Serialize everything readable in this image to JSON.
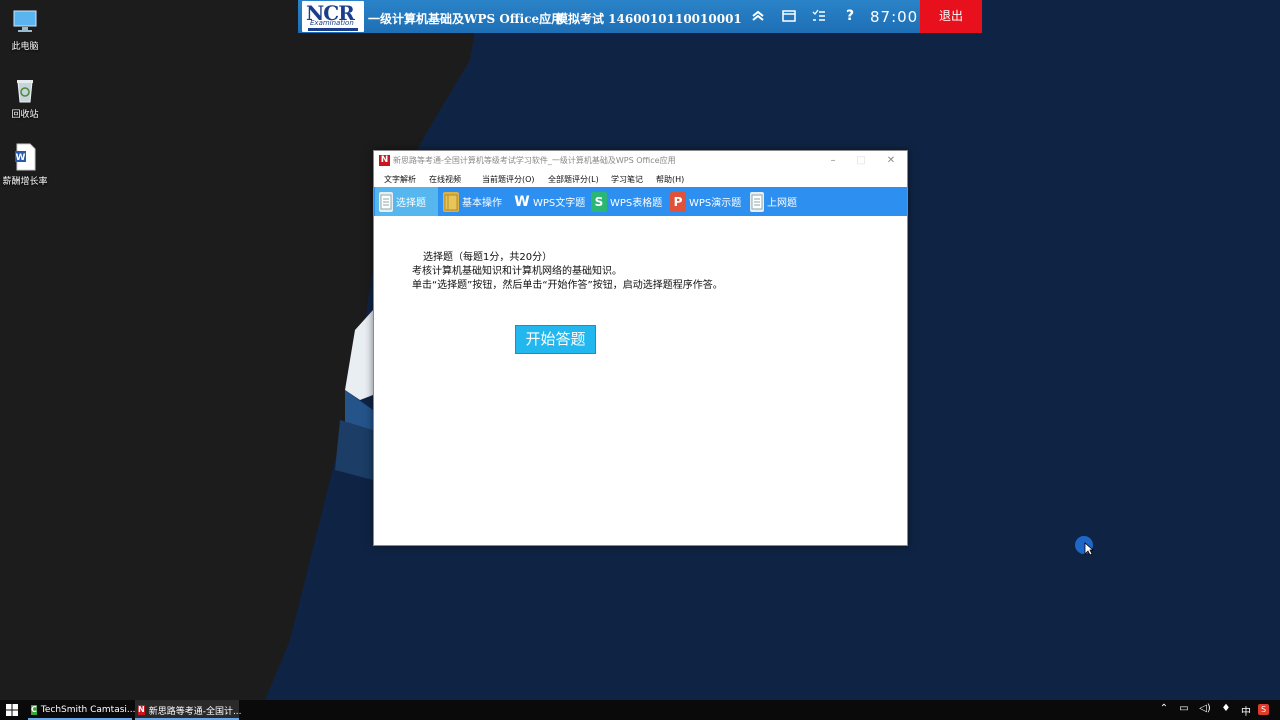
{
  "desktop": {
    "icons": [
      {
        "label": "此电脑",
        "icon": "computer-icon"
      },
      {
        "label": "回收站",
        "icon": "recycle-bin-icon"
      },
      {
        "label": "薪酬增长率",
        "icon": "word-document-icon"
      }
    ]
  },
  "exam_bar": {
    "logo_text": "NCR",
    "logo_sub": "Examination",
    "title": "一级计算机基础及WPS Office应用",
    "exam_label": "模拟考试 1460010110010001",
    "icons": [
      "collapse-icon",
      "window-icon",
      "question-list-icon",
      "help-icon"
    ],
    "help_label": "?",
    "timer": "87:00",
    "exit_label": "退出",
    "colors": {
      "bar": "#1e6fb5",
      "exit": "#e8101c"
    }
  },
  "app_window": {
    "title": "新思路等考通-全国计算机等级考试学习软件_一级计算机基础及WPS Office应用",
    "app_icon_letter": "N",
    "menu": [
      "文字解析",
      "在线视频",
      "当前题评分(O)",
      "全部题评分(L)",
      "学习笔记",
      "帮助(H)"
    ],
    "toolbar": [
      {
        "label": "选择题",
        "icon": "choice-doc-icon",
        "active": true
      },
      {
        "label": "基本操作",
        "icon": "folder-icon",
        "active": false
      },
      {
        "label": "WPS文字题",
        "icon": "wps-writer-icon",
        "active": false
      },
      {
        "label": "WPS表格题",
        "icon": "wps-spreadsheet-icon",
        "active": false
      },
      {
        "label": "WPS演示题",
        "icon": "wps-presentation-icon",
        "active": false
      },
      {
        "label": "上网题",
        "icon": "internet-doc-icon",
        "active": false
      }
    ],
    "content": {
      "line1": "选择题（每题1分，共20分）",
      "line2": "考核计算机基础知识和计算机网络的基础知识。",
      "line3": "单击“选择题”按钮，然后单击“开始作答”按钮，启动选择题程序作答。",
      "start_button": "开始答题"
    },
    "colors": {
      "toolbar": "#2d8ff0",
      "start_button": "#22b7ee"
    }
  },
  "taskbar": {
    "apps": [
      {
        "label": "TechSmith Camtasi...",
        "icon": "camtasia-icon"
      },
      {
        "label": "新思路等考通-全国计...",
        "icon": "app-n-icon"
      }
    ],
    "tray": {
      "ime": "中"
    }
  }
}
